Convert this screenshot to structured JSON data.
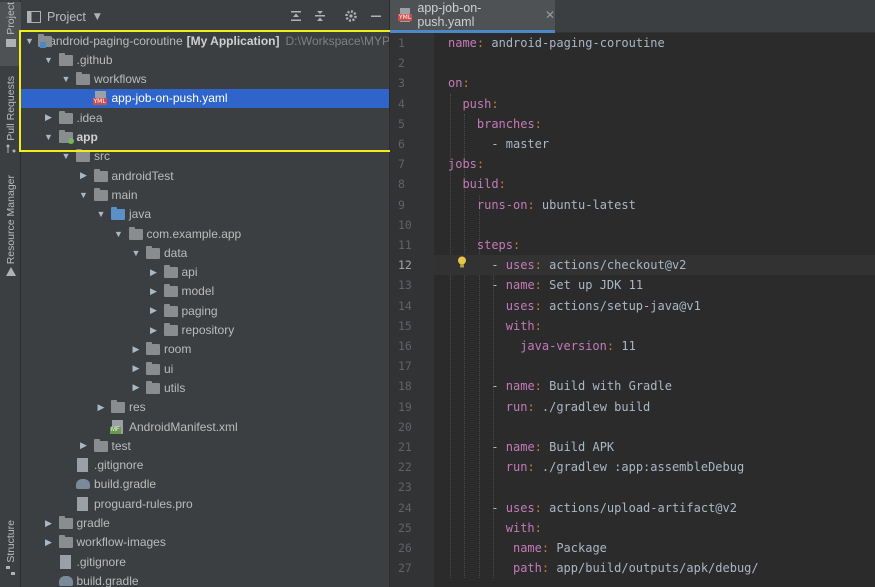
{
  "toolstrip": {
    "tabs": [
      {
        "label": "Project"
      },
      {
        "label": "Pull Requests"
      },
      {
        "label": "Resource Manager"
      },
      {
        "label": "Structure"
      }
    ]
  },
  "project_panel": {
    "title": "Project",
    "tree": [
      {
        "label": "android-paging-coroutine",
        "bold_suffix": "[My Application]",
        "path": "D:\\Workspace\\MYP"
      },
      {
        "label": ".github"
      },
      {
        "label": "workflows"
      },
      {
        "label": "app-job-on-push.yaml"
      },
      {
        "label": ".idea"
      },
      {
        "label": "app"
      },
      {
        "label": "src"
      },
      {
        "label": "androidTest"
      },
      {
        "label": "main"
      },
      {
        "label": "java"
      },
      {
        "label": "com.example.app"
      },
      {
        "label": "data"
      },
      {
        "label": "api"
      },
      {
        "label": "model"
      },
      {
        "label": "paging"
      },
      {
        "label": "repository"
      },
      {
        "label": "room"
      },
      {
        "label": "ui"
      },
      {
        "label": "utils"
      },
      {
        "label": "res"
      },
      {
        "label": "AndroidManifest.xml"
      },
      {
        "label": "test"
      },
      {
        "label": ".gitignore"
      },
      {
        "label": "build.gradle"
      },
      {
        "label": "proguard-rules.pro"
      },
      {
        "label": "gradle"
      },
      {
        "label": "workflow-images"
      },
      {
        "label": ".gitignore"
      },
      {
        "label": "build.gradle"
      }
    ]
  },
  "editor": {
    "tab_label": "app-job-on-push.yaml",
    "current_line": 12,
    "lines": [
      {
        "n": "1",
        "key": "name",
        "val": " android-paging-coroutine"
      },
      {
        "n": "2",
        "key": "",
        "val": ""
      },
      {
        "n": "3",
        "key": "on",
        "val": ""
      },
      {
        "n": "4",
        "key": "push",
        "val": ""
      },
      {
        "n": "5",
        "key": "branches",
        "val": ""
      },
      {
        "n": "6",
        "key": "",
        "val": "- master"
      },
      {
        "n": "7",
        "key": "jobs",
        "val": ""
      },
      {
        "n": "8",
        "key": "build",
        "val": ""
      },
      {
        "n": "9",
        "key": "runs-on",
        "val": " ubuntu-latest"
      },
      {
        "n": "10",
        "key": "",
        "val": ""
      },
      {
        "n": "11",
        "key": "steps",
        "val": ""
      },
      {
        "n": "12",
        "key": "uses",
        "val": " actions/checkout@v2"
      },
      {
        "n": "13",
        "key": "name",
        "val": " Set up JDK 11"
      },
      {
        "n": "14",
        "key": "uses",
        "val": " actions/setup-java@v1"
      },
      {
        "n": "15",
        "key": "with",
        "val": ""
      },
      {
        "n": "16",
        "key": "java-version",
        "val": " 11"
      },
      {
        "n": "17",
        "key": "",
        "val": ""
      },
      {
        "n": "18",
        "key": "name",
        "val": " Build with Gradle"
      },
      {
        "n": "19",
        "key": "run",
        "val": " ./gradlew build"
      },
      {
        "n": "20",
        "key": "",
        "val": ""
      },
      {
        "n": "21",
        "key": "name",
        "val": " Build APK"
      },
      {
        "n": "22",
        "key": "run",
        "val": " ./gradlew :app:assembleDebug"
      },
      {
        "n": "23",
        "key": "",
        "val": ""
      },
      {
        "n": "24",
        "key": "uses",
        "val": " actions/upload-artifact@v2"
      },
      {
        "n": "25",
        "key": "with",
        "val": ""
      },
      {
        "n": "26",
        "key": "name",
        "val": " Package"
      },
      {
        "n": "27",
        "key": "path",
        "val": " app/build/outputs/apk/debug/"
      }
    ]
  },
  "colors": {
    "selection": "#2f65ca",
    "highlight_box": "#f2ee18",
    "yaml_key": "#c47ab8",
    "code_text": "#a9b7c6"
  }
}
